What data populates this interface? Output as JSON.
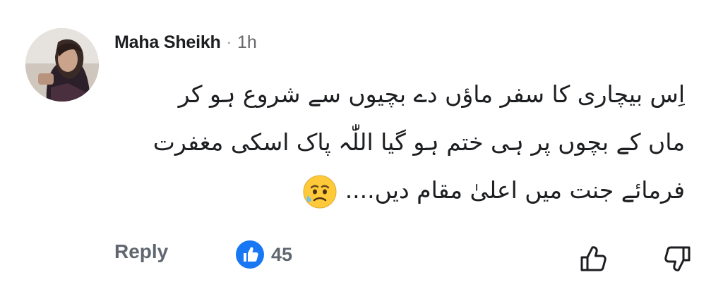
{
  "comment": {
    "author": "Maha Sheikh",
    "separator": "·",
    "time": "1h",
    "lines": [
      "اِس بیچاری کا سفر ماؤں دے بچیوں سے شروع ہو کر",
      "ماں کے بچوں پر ہی ختم ہو گیا اللّٰہ پاک اسکی مغفرت",
      "فرمائے جنت میں اعلیٰ مقام دیں...."
    ],
    "emoji": "sad-relieved-face-emoji"
  },
  "actions": {
    "reply_label": "Reply",
    "like_count": "45"
  },
  "colors": {
    "like_blue": "#1877f2",
    "muted_text": "#606770"
  }
}
